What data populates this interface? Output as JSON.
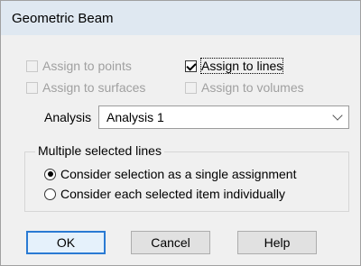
{
  "window": {
    "title": "Geometric Beam"
  },
  "assign": {
    "points": {
      "label": "Assign to points",
      "checked": false,
      "enabled": false
    },
    "lines": {
      "label": "Assign to lines",
      "checked": true,
      "enabled": true
    },
    "surfaces": {
      "label": "Assign to surfaces",
      "checked": false,
      "enabled": false
    },
    "volumes": {
      "label": "Assign to volumes",
      "checked": false,
      "enabled": false
    }
  },
  "analysis": {
    "label": "Analysis",
    "selected": "Analysis 1"
  },
  "multiple": {
    "title": "Multiple selected lines",
    "option_single": "Consider selection as a single assignment",
    "option_individual": "Consider each selected item individually",
    "selected": "single"
  },
  "buttons": {
    "ok": "OK",
    "cancel": "Cancel",
    "help": "Help"
  },
  "colors": {
    "titlebar": "#dfe8f1",
    "default_button_border": "#2a7ad3",
    "disabled_text": "#a0a0a0"
  }
}
